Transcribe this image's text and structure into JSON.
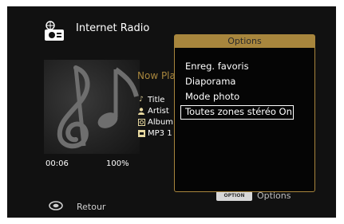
{
  "header": {
    "title": "Internet Radio",
    "icon": "radio-icon"
  },
  "now_playing": {
    "label": "Now Playing"
  },
  "metadata": [
    {
      "icon": "note-icon",
      "label": "Title"
    },
    {
      "icon": "artist-icon",
      "label": "Artist"
    },
    {
      "icon": "album-icon",
      "label": "Album"
    },
    {
      "icon": "format-icon",
      "label": "MP3 1"
    }
  ],
  "playback": {
    "elapsed": "00:06",
    "progress": "100%"
  },
  "footer": {
    "options_key": "OPTION",
    "options_label": "Options",
    "return_label": "Retour"
  },
  "options_menu": {
    "title": "Options",
    "items": [
      "Enreg. favoris",
      "Diaporama",
      "Mode photo",
      "Toutes zones stéréo On"
    ],
    "selected_index": 3
  },
  "colors": {
    "accent": "#a8863d",
    "background": "#111111"
  }
}
